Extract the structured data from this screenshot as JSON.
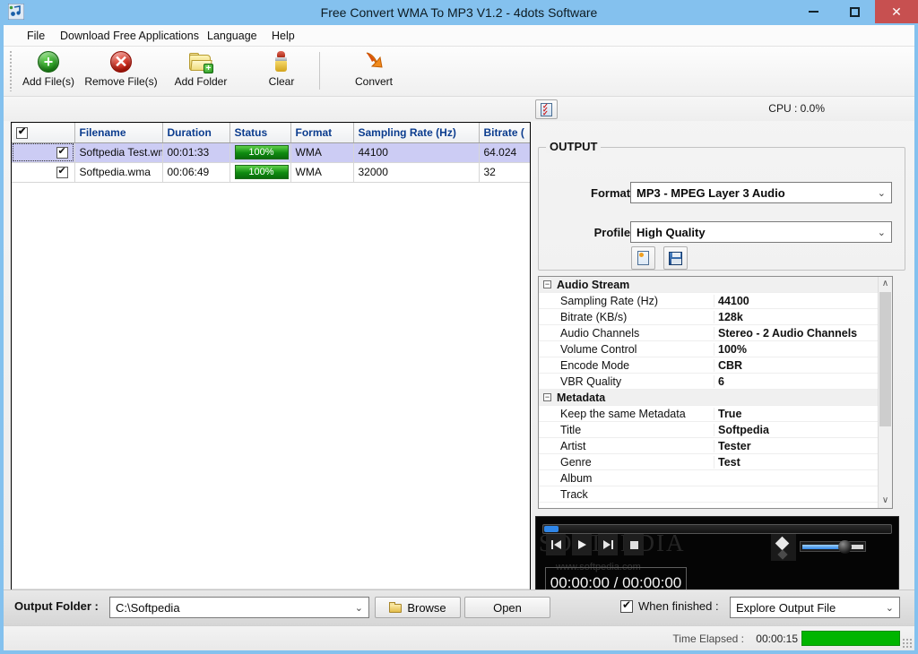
{
  "window": {
    "title": "Free Convert WMA To MP3 V1.2 - 4dots Software",
    "app_icon": "music-note-icon",
    "minimize_label": "–",
    "maximize_label": "□",
    "close_label": "✕",
    "accent_color": "#84c1ee",
    "close_color": "#c75050"
  },
  "menu": {
    "items": [
      {
        "label": "File"
      },
      {
        "label": "Download Free Applications"
      },
      {
        "label": "Language"
      },
      {
        "label": "Help"
      }
    ]
  },
  "toolbar": {
    "buttons": [
      {
        "label": "Add File(s)",
        "icon": "green-plus-circle-icon"
      },
      {
        "label": "Remove File(s)",
        "icon": "red-x-circle-icon"
      },
      {
        "label": "Add Folder",
        "icon": "folder-add-icon"
      },
      {
        "label": "Clear",
        "icon": "brush-icon"
      },
      {
        "label": "Convert",
        "icon": "orange-arrow-icon"
      }
    ]
  },
  "cpu": {
    "label": "CPU : 0.0%",
    "checklist_icon": "checklist-icon"
  },
  "filelist": {
    "columns": [
      {
        "key": "check",
        "label": ""
      },
      {
        "key": "filename",
        "label": "Filename"
      },
      {
        "key": "duration",
        "label": "Duration"
      },
      {
        "key": "status",
        "label": "Status"
      },
      {
        "key": "format",
        "label": "Format"
      },
      {
        "key": "sampling",
        "label": "Sampling Rate (Hz)"
      },
      {
        "key": "bitrate",
        "label": "Bitrate ("
      }
    ],
    "header_checkbox_checked": true,
    "rows": [
      {
        "checked": true,
        "filename": "Softpedia Test.wma",
        "duration": "00:01:33",
        "status": "100%",
        "format": "WMA",
        "sampling": "44100",
        "bitrate": "64.024",
        "selected": true
      },
      {
        "checked": true,
        "filename": "Softpedia.wma",
        "duration": "00:06:49",
        "status": "100%",
        "format": "WMA",
        "sampling": "32000",
        "bitrate": "32",
        "selected": false
      }
    ],
    "scroll_left_arrow": "‹",
    "scroll_right_arrow": "›"
  },
  "output": {
    "legend": "OUTPUT",
    "format_label": "Format :",
    "format_value": "MP3 - MPEG Layer 3 Audio",
    "profile_label": "Profile :",
    "profile_value": "High Quality",
    "new_profile_icon": "new-document-icon",
    "save_profile_icon": "save-floppy-icon",
    "dropdown_arrow": "⌄"
  },
  "properties": {
    "groups": [
      {
        "name": "Audio Stream",
        "expander": "−",
        "rows": [
          {
            "name": "Sampling Rate (Hz)",
            "value": "44100"
          },
          {
            "name": "Bitrate (KB/s)",
            "value": "128k"
          },
          {
            "name": "Audio Channels",
            "value": "Stereo - 2 Audio Channels"
          },
          {
            "name": "Volume Control",
            "value": "100%"
          },
          {
            "name": "Encode Mode",
            "value": "CBR"
          },
          {
            "name": "VBR Quality",
            "value": "6"
          }
        ]
      },
      {
        "name": "Metadata",
        "expander": "−",
        "rows": [
          {
            "name": "Keep the same Metadata",
            "value": "True"
          },
          {
            "name": "Title",
            "value": "Softpedia"
          },
          {
            "name": "Artist",
            "value": "Tester"
          },
          {
            "name": "Genre",
            "value": "Test"
          },
          {
            "name": "Album",
            "value": ""
          },
          {
            "name": "Track",
            "value": ""
          }
        ]
      }
    ],
    "scroll_up_arrow": "∧",
    "scroll_down_arrow": "∨"
  },
  "player": {
    "time_display": "00:00:00 / 00:00:00",
    "watermark": "SOFTPEDIA",
    "watermark_url": "www.softpedia.com",
    "buttons": [
      {
        "name": "previous",
        "icon": "skip-previous-icon"
      },
      {
        "name": "play",
        "icon": "play-icon"
      },
      {
        "name": "next",
        "icon": "skip-next-icon"
      },
      {
        "name": "stop",
        "icon": "stop-icon"
      }
    ],
    "volume_icon": "volume-icon"
  },
  "bottom": {
    "output_folder_label": "Output Folder :",
    "output_folder_value": "C:\\Softpedia",
    "browse_label": "Browse",
    "open_label": "Open",
    "when_finished_label": "When finished :",
    "when_finished_checked": true,
    "when_finished_value": "Explore Output File",
    "dropdown_arrow": "⌄"
  },
  "status": {
    "time_elapsed_label": "Time Elapsed :",
    "time_elapsed_value": "00:00:15",
    "progress_color": "#00b500"
  }
}
